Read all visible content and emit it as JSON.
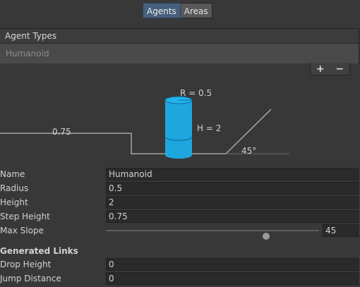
{
  "tabs": [
    {
      "label": "Agents",
      "active": true
    },
    {
      "label": "Areas",
      "active": false
    }
  ],
  "agent_list": {
    "header": "Agent Types",
    "items": [
      "Humanoid"
    ],
    "add_label": "+",
    "remove_label": "−"
  },
  "diagram": {
    "radius_label": "R = 0.5",
    "height_label": "H = 2",
    "step_label": "0.75",
    "slope_label": "45°",
    "agent_color": "#1ea6de",
    "line_color": "#a6a6a6"
  },
  "fields": {
    "name": {
      "label": "Name",
      "value": "Humanoid"
    },
    "radius": {
      "label": "Radius",
      "value": "0.5"
    },
    "height": {
      "label": "Height",
      "value": "2"
    },
    "step_height": {
      "label": "Step Height",
      "value": "0.75"
    },
    "max_slope": {
      "label": "Max Slope",
      "value": "45",
      "fraction": 0.75
    }
  },
  "generated_links": {
    "title": "Generated Links",
    "drop_height": {
      "label": "Drop Height",
      "value": "0"
    },
    "jump_distance": {
      "label": "Jump Distance",
      "value": "0"
    }
  }
}
